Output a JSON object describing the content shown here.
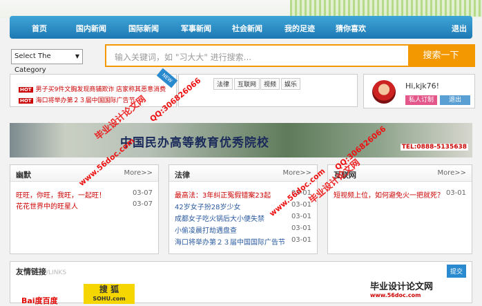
{
  "nav": [
    "首页",
    "国内新闻",
    "国际新闻",
    "军事新闻",
    "社会新闻",
    "我的足迹",
    "猜你喜欢",
    "退出"
  ],
  "search": {
    "category": "Select The Category",
    "placeholder": "输入关键词，如 \"习大大\" 进行搜索...",
    "button": "搜索一下"
  },
  "hot": [
    {
      "badge": "HOT",
      "text": "男子买9件文胸发现商铺欺诈 店家称其恶意消费"
    },
    {
      "badge": "HOT",
      "text": "海口将举办第２３届中国国际广告节"
    }
  ],
  "newtag": "NEW",
  "tags": [
    "法律",
    "互联网",
    "视频",
    "娱乐"
  ],
  "user": {
    "greeting": "Hi,kjk76!",
    "order": "私人订制",
    "logout": "退出"
  },
  "banner": {
    "title": "中国民办高等教育优秀院校",
    "tel": "TEL:0888-5135638"
  },
  "panels": [
    {
      "title": "幽默",
      "more": "More>>",
      "items": [
        {
          "text": "旺旺，你旺，我旺，一起旺！",
          "date": "03-07",
          "color": "#c00"
        },
        {
          "text": "花花世界中的旺星人",
          "date": "03-07",
          "color": "#c00"
        }
      ]
    },
    {
      "title": "法律",
      "more": "More>>",
      "items": [
        {
          "text": "最高法：3年纠正冤假错案23起",
          "date": "03-01",
          "color": "#c00"
        },
        {
          "text": "42岁女子扮28岁少女",
          "date": "03-01",
          "color": "#2a5aa0"
        },
        {
          "text": "成都女子吃火锅后大小便失禁",
          "date": "03-01",
          "color": "#2a5aa0"
        },
        {
          "text": "小偷凌晨打劫遇盘查",
          "date": "03-01",
          "color": "#2a5aa0"
        },
        {
          "text": "海口将举办第２３届中国国际广告节",
          "date": "03-01",
          "color": "#2a5aa0"
        }
      ]
    },
    {
      "title": "互联网",
      "more": "More>>",
      "items": [
        {
          "text": "短视频上位，如何避免火一把就死？",
          "date": "03-01",
          "color": "#c00"
        }
      ]
    }
  ],
  "links": {
    "title": "友情链接",
    "sub": "/LINKS",
    "submit": "提交",
    "baidu": "Bai度百度",
    "sohu": "搜 狐",
    "sohu2": "SOHU.com"
  },
  "watermarks": {
    "site": "毕业设计论文网",
    "qq": "QQ:306826066",
    "url": "www.56doc.com",
    "foot": "毕业设计论文网",
    "foot2": "www.56doc.com"
  }
}
